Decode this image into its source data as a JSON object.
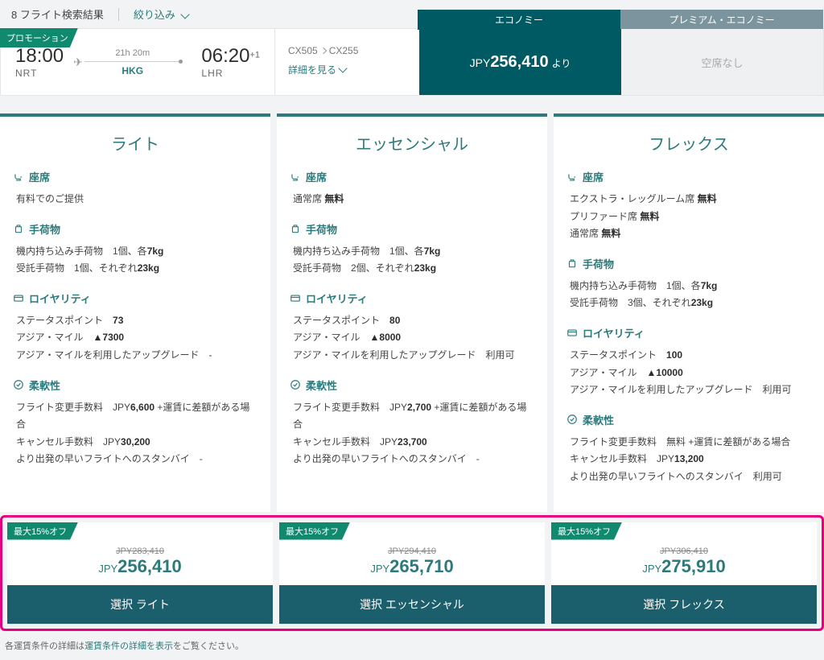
{
  "topbar": {
    "results": "8 フライト検索結果",
    "filter": "絞り込み"
  },
  "promo": "プロモーション",
  "flight": {
    "dep_time": "18:00",
    "dep_code": "NRT",
    "duration": "21h 20m",
    "stop": "HKG",
    "arr_time": "06:20",
    "arr_plus": "+1",
    "arr_code": "LHR",
    "codes_a": "CX505",
    "codes_b": "CX255",
    "detail": "詳細を見る"
  },
  "tabs": {
    "economy": {
      "label": "エコノミー",
      "prefix": "JPY",
      "price": "256,410",
      "suffix": "より"
    },
    "premium": {
      "label": "プレミアム・エコノミー",
      "text": "空席なし"
    }
  },
  "fares": [
    {
      "title": "ライト",
      "seat_head": "座席",
      "seat_lines": [
        "有料でのご提供"
      ],
      "bag_head": "手荷物",
      "bag_lines": [
        "機内持ち込み手荷物　1個、各<b>7kg</b>",
        "受託手荷物　1個、それぞれ<b>23kg</b>"
      ],
      "loy_head": "ロイヤリティ",
      "loy_lines": [
        "ステータスポイント　<b>73</b>",
        "アジア・マイル　<b>▲7300</b>",
        "アジア・マイルを利用したアップグレード　-"
      ],
      "flex_head": "柔軟性",
      "flex_lines": [
        "フライト変更手数料　JPY<b>6,600</b> +運賃に差額がある場合",
        "キャンセル手数料　JPY<b>30,200</b>",
        "より出発の早いフライトへのスタンバイ　-"
      ],
      "discount": "最大15%オフ",
      "old": "JPY283,410",
      "cur": "JPY",
      "price": "256,410",
      "btn": "選択 ライト"
    },
    {
      "title": "エッセンシャル",
      "seat_head": "座席",
      "seat_lines": [
        "通常席 <b>無料</b>"
      ],
      "bag_head": "手荷物",
      "bag_lines": [
        "機内持ち込み手荷物　1個、各<b>7kg</b>",
        "受託手荷物　2個、それぞれ<b>23kg</b>"
      ],
      "loy_head": "ロイヤリティ",
      "loy_lines": [
        "ステータスポイント　<b>80</b>",
        "アジア・マイル　<b>▲8000</b>",
        "アジア・マイルを利用したアップグレード　利用可"
      ],
      "flex_head": "柔軟性",
      "flex_lines": [
        "フライト変更手数料　JPY<b>2,700</b> +運賃に差額がある場合",
        "キャンセル手数料　JPY<b>23,700</b>",
        "より出発の早いフライトへのスタンバイ　-"
      ],
      "discount": "最大15%オフ",
      "old": "JPY294,410",
      "cur": "JPY",
      "price": "265,710",
      "btn": "選択 エッセンシャル"
    },
    {
      "title": "フレックス",
      "seat_head": "座席",
      "seat_lines": [
        "エクストラ・レッグルーム席 <b>無料</b>",
        "プリファード席 <b>無料</b>",
        "通常席 <b>無料</b>"
      ],
      "bag_head": "手荷物",
      "bag_lines": [
        "機内持ち込み手荷物　1個、各<b>7kg</b>",
        "受託手荷物　3個、それぞれ<b>23kg</b>"
      ],
      "loy_head": "ロイヤリティ",
      "loy_lines": [
        "ステータスポイント　<b>100</b>",
        "アジア・マイル　<b>▲10000</b>",
        "アジア・マイルを利用したアップグレード　利用可"
      ],
      "flex_head": "柔軟性",
      "flex_lines": [
        "フライト変更手数料　無料 +運賃に差額がある場合",
        "キャンセル手数料　JPY<b>13,200</b>",
        "より出発の早いフライトへのスタンバイ　利用可"
      ],
      "discount": "最大15%オフ",
      "old": "JPY306,410",
      "cur": "JPY",
      "price": "275,910",
      "btn": "選択 フレックス"
    }
  ],
  "footnote": {
    "prefix": "各運賃条件の詳細は",
    "link": "運賃条件の詳細を表示",
    "suffix": "をご覧ください。"
  }
}
